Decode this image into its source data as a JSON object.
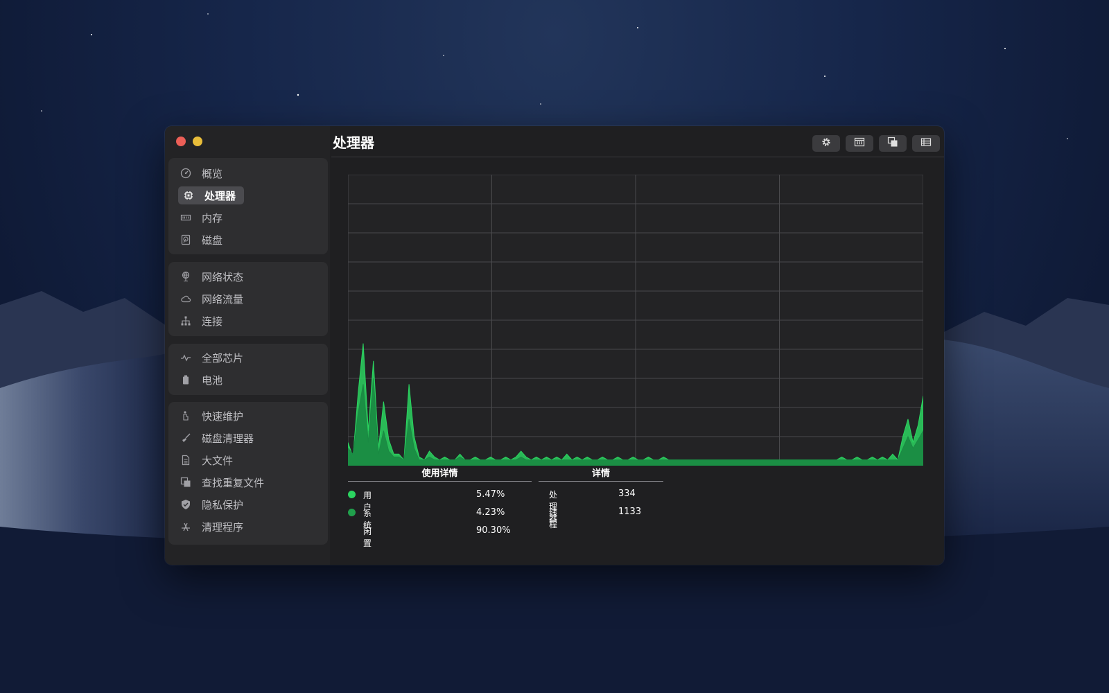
{
  "window": {
    "title": "处理器"
  },
  "sidebar": {
    "groups": [
      {
        "items": [
          {
            "label": "概览",
            "icon": "gauge-icon"
          },
          {
            "label": "处理器",
            "icon": "cpu-icon",
            "active": true
          },
          {
            "label": "内存",
            "icon": "memory-icon"
          },
          {
            "label": "磁盘",
            "icon": "disk-icon"
          }
        ]
      },
      {
        "items": [
          {
            "label": "网络状态",
            "icon": "globe-icon"
          },
          {
            "label": "网络流量",
            "icon": "cloud-icon"
          },
          {
            "label": "连接",
            "icon": "network-tree-icon"
          }
        ]
      },
      {
        "items": [
          {
            "label": "全部芯片",
            "icon": "pulse-icon"
          },
          {
            "label": "电池",
            "icon": "battery-icon"
          }
        ]
      },
      {
        "items": [
          {
            "label": "快速维护",
            "icon": "maintenance-icon"
          },
          {
            "label": "磁盘清理器",
            "icon": "broom-icon"
          },
          {
            "label": "大文件",
            "icon": "document-icon"
          },
          {
            "label": "查找重复文件",
            "icon": "duplicate-icon"
          },
          {
            "label": "隐私保护",
            "icon": "shield-icon"
          },
          {
            "label": "清理程序",
            "icon": "app-store-icon"
          }
        ]
      }
    ]
  },
  "toolbar": {
    "buttons": [
      "gear-icon",
      "calendar-icon",
      "windows-icon",
      "list-icon"
    ]
  },
  "usage": {
    "heading": "使用详情",
    "rows": [
      {
        "label": "用户",
        "value": "5.47%",
        "color": "#2bd460"
      },
      {
        "label": "系统",
        "value": "4.23%",
        "color": "#20a04c"
      },
      {
        "label": "闲置",
        "value": "90.30%"
      }
    ]
  },
  "details": {
    "heading": "详情",
    "rows": [
      {
        "label": "处理器",
        "value": "334"
      },
      {
        "label": "线程",
        "value": "1133"
      }
    ]
  },
  "colors": {
    "user": "#2bd460",
    "system": "#1a8a43",
    "chart_bg": "#232325",
    "grid": "#4a4a4d"
  },
  "chart_data": {
    "type": "area",
    "ylim": [
      0,
      100
    ],
    "grid": true,
    "series": [
      {
        "name": "用户",
        "values": [
          8,
          3,
          25,
          42,
          12,
          36,
          6,
          22,
          9,
          4,
          4,
          2,
          28,
          10,
          3,
          2,
          5,
          3,
          2,
          3,
          2,
          2,
          4,
          2,
          2,
          3,
          2,
          2,
          3,
          2,
          2,
          3,
          2,
          3,
          5,
          3,
          2,
          3,
          2,
          3,
          2,
          3,
          2,
          4,
          2,
          3,
          2,
          3,
          2,
          2,
          3,
          2,
          2,
          3,
          2,
          2,
          3,
          2,
          2,
          3,
          2,
          2,
          3,
          2,
          2,
          2,
          2,
          2,
          2,
          2,
          2,
          2,
          2,
          2,
          2,
          2,
          2,
          2,
          2,
          2,
          2,
          2,
          2,
          2,
          2,
          2,
          2,
          2,
          2,
          2,
          2,
          2,
          2,
          2,
          2,
          2,
          2,
          3,
          2,
          2,
          3,
          2,
          2,
          3,
          2,
          3,
          2,
          4,
          2,
          10,
          16,
          8,
          14,
          24
        ]
      },
      {
        "name": "系统",
        "values": [
          6,
          4,
          18,
          28,
          8,
          30,
          4,
          12,
          5,
          3,
          3,
          2,
          16,
          6,
          2,
          2,
          3,
          2,
          2,
          2,
          2,
          2,
          3,
          2,
          2,
          2,
          2,
          2,
          2,
          2,
          2,
          2,
          2,
          2,
          3,
          2,
          2,
          2,
          2,
          2,
          2,
          2,
          2,
          2,
          2,
          2,
          2,
          2,
          2,
          2,
          2,
          2,
          2,
          2,
          2,
          2,
          2,
          2,
          2,
          2,
          2,
          2,
          2,
          2,
          2,
          2,
          2,
          2,
          2,
          2,
          2,
          2,
          2,
          2,
          2,
          2,
          2,
          2,
          2,
          2,
          2,
          2,
          2,
          2,
          2,
          2,
          2,
          2,
          2,
          2,
          2,
          2,
          2,
          2,
          2,
          2,
          2,
          2,
          2,
          2,
          2,
          2,
          2,
          2,
          2,
          2,
          2,
          2,
          2,
          6,
          10,
          6,
          9,
          12
        ]
      }
    ]
  }
}
